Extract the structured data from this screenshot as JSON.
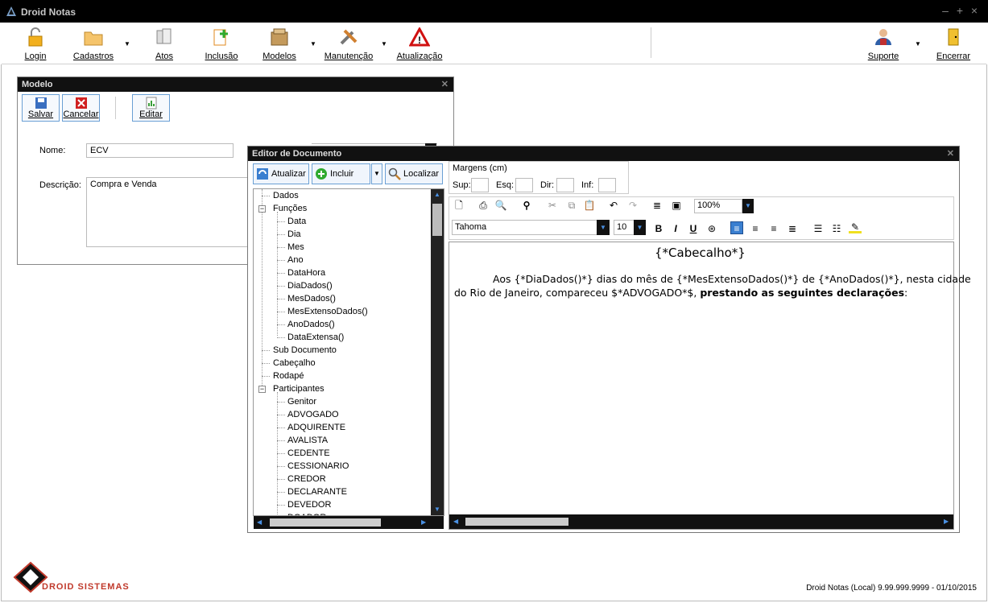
{
  "app": {
    "title": "Droid Notas",
    "window_controls": [
      "–",
      "+",
      "×"
    ]
  },
  "ribbon": {
    "items": [
      {
        "label": "Login"
      },
      {
        "label": "Cadastros"
      },
      {
        "label": "Atos"
      },
      {
        "label": "Inclusão"
      },
      {
        "label": "Modelos"
      },
      {
        "label": "Manutenção"
      },
      {
        "label": "Atualização"
      },
      {
        "label": "Suporte"
      },
      {
        "label": "Encerrar"
      }
    ]
  },
  "modelo": {
    "title": "Modelo",
    "buttons": {
      "save": "Salvar",
      "cancel": "Cancelar",
      "edit": "Editar"
    },
    "nome_label": "Nome:",
    "nome_value": "ECV",
    "descricao_label": "Descrição:",
    "descricao_value": "Compra e Venda"
  },
  "editor": {
    "title": "Editor de Documento",
    "buttons": {
      "atualizar": "Atualizar",
      "incluir": "Incluir",
      "localizar": "Localizar"
    },
    "margins": {
      "group_label": "Margens (cm)",
      "sup": "Sup:",
      "esq": "Esq:",
      "dir": "Dir:",
      "inf": "Inf:"
    },
    "zoom": "100%",
    "font_name": "Tahoma",
    "font_size": "10",
    "format_buttons": {
      "bold": "B",
      "italic": "I",
      "underline": "U"
    },
    "tree": {
      "dados": "Dados",
      "funcoes": "Funções",
      "funcoes_children": [
        "Data",
        "Dia",
        "Mes",
        "Ano",
        "DataHora",
        "DiaDados()",
        "MesDados()",
        "MesExtensoDados()",
        "AnoDados()",
        "DataExtensa()"
      ],
      "sub_documento": "Sub Documento",
      "cabecalho": "Cabeçalho",
      "rodape": "Rodapé",
      "participantes": "Participantes",
      "participantes_children": [
        "Genitor",
        "ADVOGADO",
        "ADQUIRENTE",
        "AVALISTA",
        "CEDENTE",
        "CESSIONARIO",
        "CREDOR",
        "DECLARANTE",
        "DEVEDOR",
        "DOADOR"
      ]
    },
    "document": {
      "header": "{*Cabecalho*}",
      "line1": "Aos {*DiaDados()*} dias do mês de {*MesExtensoDados()*} de {*AnoDados()*}, nesta cidade",
      "line2_normal": "do Rio de Janeiro, compareceu $*ADVOGADO*$, ",
      "line2_bold": "prestando as seguintes declarações",
      "line2_end": ":"
    }
  },
  "footer": {
    "logo": "DROID SISTEMAS",
    "status": "Droid Notas (Local) 9.99.999.9999 - 01/10/2015"
  },
  "colors": {
    "titlebar": "#000000",
    "accent": "#6a9fd4",
    "logo": "#c0392b"
  }
}
